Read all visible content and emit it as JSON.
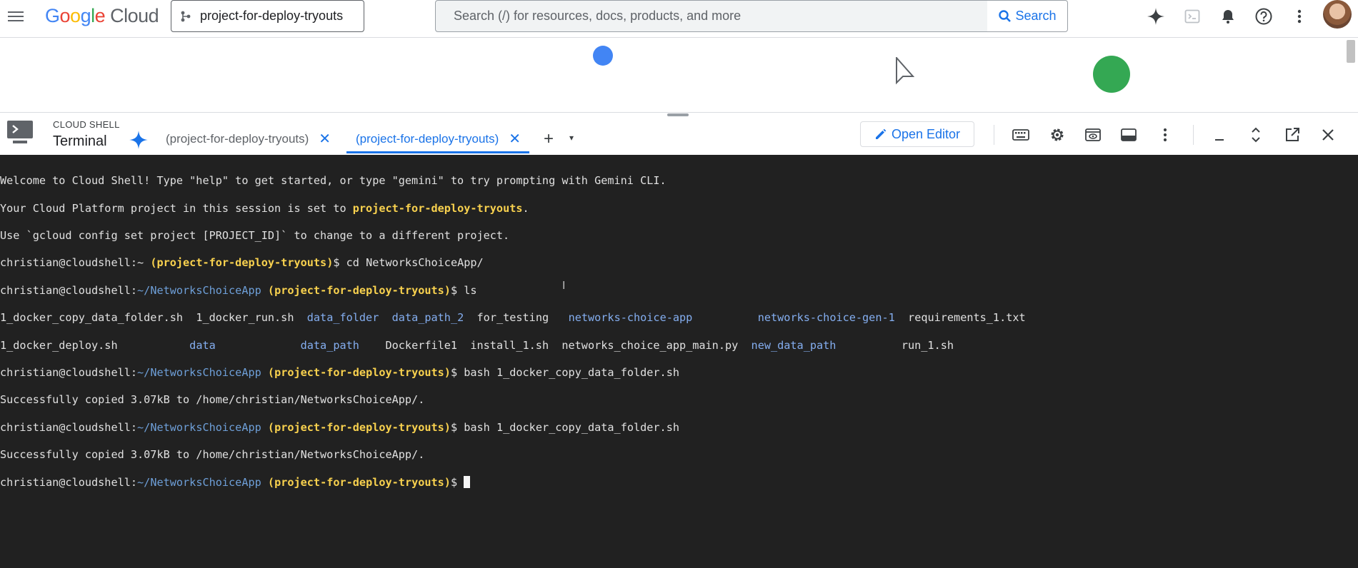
{
  "topbar": {
    "logo_google": "Google",
    "logo_cloud": "Cloud",
    "project_name": "project-for-deploy-tryouts",
    "search_placeholder": "Search (/) for resources, docs, products, and more",
    "search_button": "Search",
    "icons": [
      "menu-icon",
      "gemini-icon",
      "cloud-shell-icon",
      "notifications-icon",
      "help-icon",
      "more-vert-icon",
      "account-avatar"
    ]
  },
  "shell": {
    "small_label": "CLOUD SHELL",
    "title": "Terminal",
    "tabs": [
      {
        "label": "(project-for-deploy-tryouts)",
        "active": false
      },
      {
        "label": "(project-for-deploy-tryouts)",
        "active": true
      }
    ],
    "add_tab": "+",
    "dropdown": "▾",
    "open_editor": "Open Editor",
    "toolbar_icons": [
      "keyboard-icon",
      "settings-icon",
      "web-preview-icon",
      "layout-icon",
      "more-vert-icon",
      "minimize-icon",
      "maximize-icon",
      "open-new-window-icon",
      "close-icon"
    ]
  },
  "terminal": {
    "welcome_line": "Welcome to Cloud Shell! Type \"help\" to get started, or type \"gemini\" to try prompting with Gemini CLI.",
    "project_line_prefix": "Your Cloud Platform project in this session is set to ",
    "project_line_project": "project-for-deploy-tryouts",
    "project_line_suffix": ".",
    "config_line": "Use `gcloud config set project [PROJECT_ID]` to change to a different project.",
    "prompt_user": "christian@cloudshell",
    "prompt_home": ":~ ",
    "prompt_path": "~/NetworksChoiceApp",
    "prompt_project": "(project-for-deploy-tryouts)",
    "prompt_symbol": "$ ",
    "cmd_cd": "cd NetworksChoiceApp/",
    "cmd_ls": "ls",
    "ls_row1": [
      {
        "text": "1_docker_copy_data_folder.sh  ",
        "kind": "file"
      },
      {
        "text": "1_docker_run.sh  ",
        "kind": "file"
      },
      {
        "text": "data_folder",
        "kind": "dir"
      },
      {
        "text": "  ",
        "kind": "file"
      },
      {
        "text": "data_path_2",
        "kind": "dir"
      },
      {
        "text": "  for_testing   ",
        "kind": "file"
      },
      {
        "text": "networks-choice-app",
        "kind": "dir"
      },
      {
        "text": "          ",
        "kind": "file"
      },
      {
        "text": "networks-choice-gen-1",
        "kind": "dir"
      },
      {
        "text": "  requirements_1.txt",
        "kind": "file"
      }
    ],
    "ls_row2": [
      {
        "text": "1_docker_deploy.sh           ",
        "kind": "file"
      },
      {
        "text": "data",
        "kind": "dir"
      },
      {
        "text": "             ",
        "kind": "file"
      },
      {
        "text": "data_path",
        "kind": "dir"
      },
      {
        "text": "    Dockerfile1  install_1.sh  networks_choice_app_main.py  ",
        "kind": "file"
      },
      {
        "text": "new_data_path",
        "kind": "dir"
      },
      {
        "text": "          run_1.sh",
        "kind": "file"
      }
    ],
    "cmd_bash": "bash 1_docker_copy_data_folder.sh",
    "success_line": "Successfully copied 3.07kB to /home/christian/NetworksChoiceApp/."
  }
}
